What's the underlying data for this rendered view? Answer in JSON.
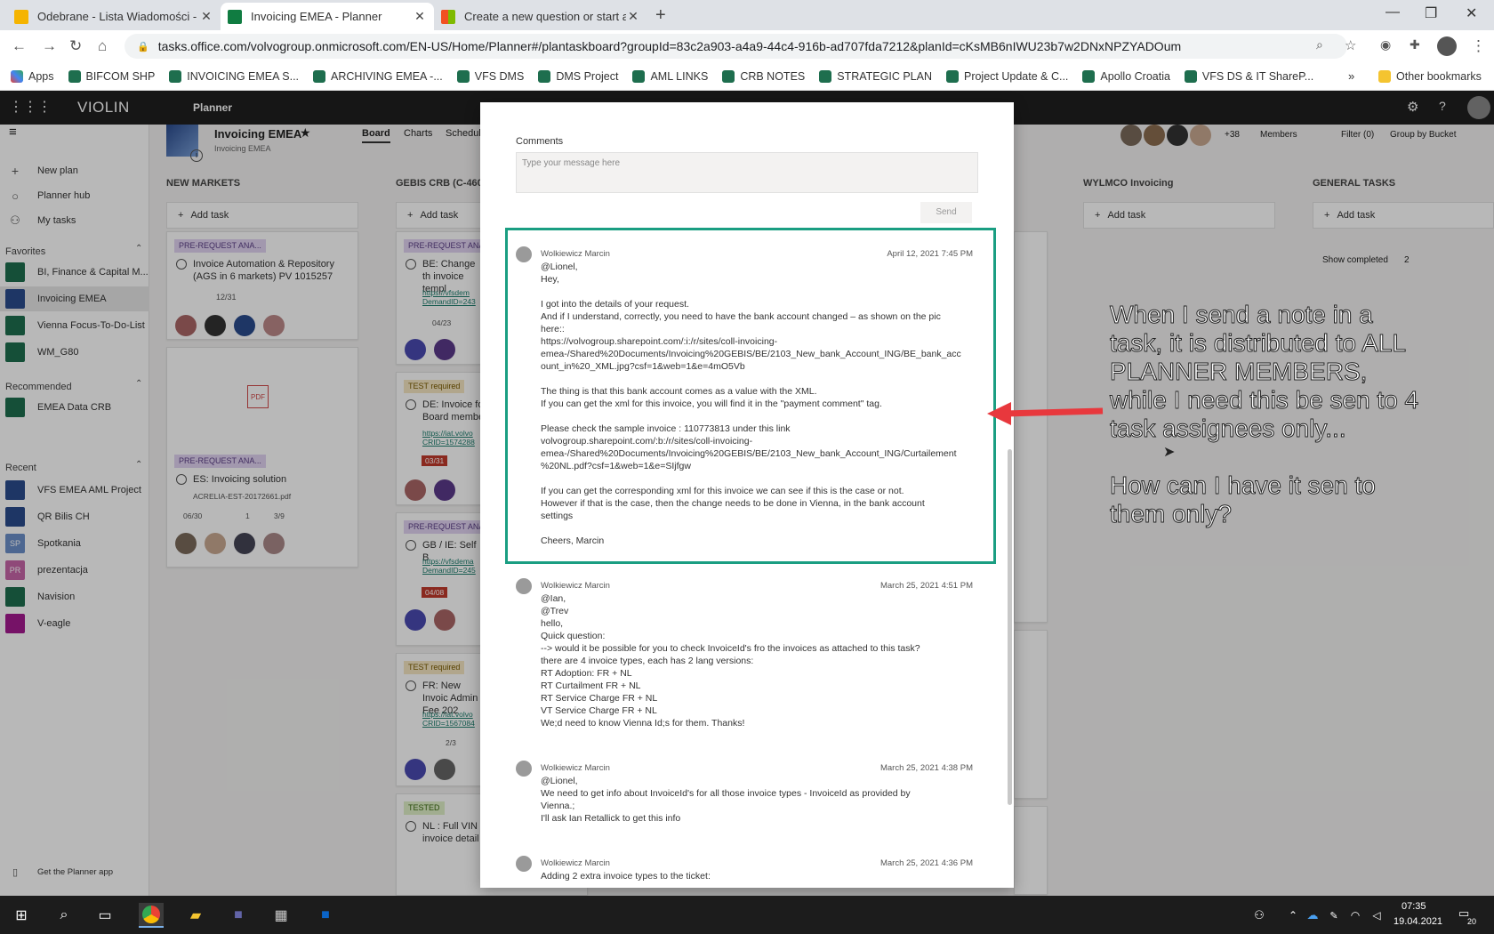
{
  "browser": {
    "tabs": [
      {
        "title": "Odebrane - Lista Wiadomości - P",
        "icon_color": "#f5b400"
      },
      {
        "title": "Invoicing EMEA - Planner",
        "icon_color": "#107c41"
      },
      {
        "title": "Create a new question or start a c",
        "icon_color": "#f25022"
      }
    ],
    "url": "tasks.office.com/volvogroup.onmicrosoft.com/EN-US/Home/Planner#/plantaskboard?groupId=83c2a903-a4a9-44c4-916b-ad707fda7212&planId=cKsMB6nIWU23b7w2DNxNPZYADOum",
    "bookmarks": [
      "Apps",
      "BIFCOM SHP",
      "INVOICING EMEA S...",
      "ARCHIVING EMEA -...",
      "VFS DMS",
      "DMS Project",
      "AML LINKS",
      "CRB NOTES",
      "STRATEGIC PLAN",
      "Project Update & C...",
      "Apollo Croatia",
      "VFS DS & IT ShareP..."
    ],
    "other_bookmarks": "Other bookmarks"
  },
  "suite": {
    "brand": "VIOLIN",
    "app": "Planner"
  },
  "leftnav": {
    "top": [
      {
        "label": "New plan"
      },
      {
        "label": "Planner hub"
      },
      {
        "label": "My tasks"
      }
    ],
    "favorites_header": "Favorites",
    "favorites": [
      "BI, Finance & Capital M...",
      "Invoicing EMEA",
      "Vienna Focus-To-Do-List",
      "WM_G80"
    ],
    "recommended_header": "Recommended",
    "recommended": [
      "EMEA Data CRB"
    ],
    "recent_header": "Recent",
    "recent": [
      {
        "label": "VFS EMEA AML Project",
        "abbr": "",
        "color": "#2a4b8d"
      },
      {
        "label": "QR Bilis CH",
        "abbr": "",
        "color": "#2a4b8d"
      },
      {
        "label": "Spotkania",
        "abbr": "SP",
        "color": "#6b8fc9"
      },
      {
        "label": "prezentacja",
        "abbr": "PR",
        "color": "#c766a8"
      },
      {
        "label": "Navision",
        "abbr": "",
        "color": "#1e6e4e"
      },
      {
        "label": "V-eagle",
        "abbr": "",
        "color": "#a4198f"
      }
    ],
    "get_app": "Get the Planner app"
  },
  "plan": {
    "title": "Invoicing EMEA",
    "subtitle": "Invoicing EMEA",
    "tabs": [
      "Board",
      "Charts",
      "Schedule"
    ],
    "members_more": "+38",
    "members": "Members",
    "filter": "Filter (0)",
    "group": "Group by Bucket",
    "show_completed": "Show completed",
    "completed_count": "2"
  },
  "buckets": [
    {
      "name": "NEW MARKETS"
    },
    {
      "name": "GEBIS CRB (C-46047"
    },
    {
      "name": "WYLMCO Invoicing"
    },
    {
      "name": "GENERAL TASKS"
    }
  ],
  "add_task": "Add task",
  "cards_col1": {
    "c1_label": "PRE-REQUEST ANA...",
    "c1_title": "Invoice Automation & Repository (AGS in 6 markets) PV 1015257",
    "c1_date": "12/31",
    "c2_label": "PRE-REQUEST ANA...",
    "c2_title": "ES: Invoicing solution",
    "c2_file": "ACRELIA-EST-20172661.pdf",
    "c2_date": "06/30",
    "c2_comments": "1",
    "c2_check": "3/9"
  },
  "cards_col2": {
    "c1_label": "PRE-REQUEST ANA...",
    "c1_title": "BE: Change th invoice templ",
    "c1_link": "https://vfsdem DemandID=243",
    "c1_date": "04/23",
    "c2_label": "TEST required",
    "c2_title": "DE: Invoice fo Board membe",
    "c2_link": "https://iat.volvo CRID=1574288",
    "c2_date": "03/31",
    "c3_label": "PRE-REQUEST ANA...",
    "c3_title": "GB / IE: Self B",
    "c3_link": "https://vfsdema DemandID=245",
    "c3_date": "04/08",
    "c4_label": "TEST required",
    "c4_title": "FR: New Invoic Admin Fee 202",
    "c4_link": "https://iat.volvo CRID=1567084",
    "c4_check": "2/3",
    "c5_label": "TESTED",
    "c5_title": "NL : Full VIN i invoice detail"
  },
  "modal": {
    "comments_label": "Comments",
    "placeholder": "Type your message here",
    "send": "Send",
    "comments": [
      {
        "author": "Wolkiewicz Marcin",
        "date": "April 12, 2021 7:45 PM",
        "lines": [
          "@Lionel,",
          "Hey,",
          "",
          "I got into the details of your request.",
          "And if I understand, correctly, you need to have the bank account changed – as shown on the pic",
          "here::",
          "https://volvogroup.sharepoint.com/:i:/r/sites/coll-invoicing-",
          "emea-/Shared%20Documents/Invoicing%20GEBIS/BE/2103_New_bank_Account_ING/BE_bank_acc",
          "ount_in%20_XML.jpg?csf=1&web=1&e=4mO5Vb",
          "",
          "The thing is that this bank account comes as a value with the XML.",
          "If you can get the xml for this invoice, you will find it in the \"payment comment\" tag.",
          "",
          "Please check the sample invoice : 110773813 under this link",
          "volvogroup.sharepoint.com/:b:/r/sites/coll-invoicing-",
          "emea-/Shared%20Documents/Invoicing%20GEBIS/BE/2103_New_bank_Account_ING/Curtailement",
          "%20NL.pdf?csf=1&web=1&e=SIjfgw",
          "",
          "If you can get the corresponding xml for this invoice we can see if this is the case or not.",
          "However if that is the case, then the change needs to be done in Vienna, in the bank account",
          "settings",
          "",
          "Cheers, Marcin"
        ]
      },
      {
        "author": "Wolkiewicz Marcin",
        "date": "March 25, 2021 4:51 PM",
        "lines": [
          "@Ian,",
          "@Trev",
          "hello,",
          "Quick question:",
          "--> would it be possible for you to check InvoiceId's fro the invoices as attached to this task?",
          "there are 4 invoice types, each has 2 lang versions:",
          "RT Adoption: FR + NL",
          "RT Curtailment FR + NL",
          "RT Service Charge FR + NL",
          "VT Service Charge FR + NL",
          "We;d need to know Vienna Id;s for them. Thanks!"
        ]
      },
      {
        "author": "Wolkiewicz Marcin",
        "date": "March 25, 2021 4:38 PM",
        "lines": [
          "@Lionel,",
          "We need to get info about InvoiceId's for all those invoice types - InvoiceId as provided by",
          "Vienna.;",
          "I'll ask Ian Retallick to get this info"
        ]
      },
      {
        "author": "Wolkiewicz Marcin",
        "date": "March 25, 2021 4:36 PM",
        "lines": [
          "Adding 2 extra invoice types to the ticket:"
        ]
      }
    ]
  },
  "annotation": {
    "text1": [
      "When I send a note in a",
      "task, it is distributed to ALL",
      "PLANNER MEMBERS,",
      "while I need this be sen to 4",
      "task assignees only..."
    ],
    "text2": [
      "How can I have it sen to",
      "them only?"
    ],
    "highlight_color": "#1a9e82",
    "arrow_color": "#e8383d"
  },
  "taskbar": {
    "time": "07:35",
    "date": "19.04.2021",
    "notifications": "20"
  }
}
